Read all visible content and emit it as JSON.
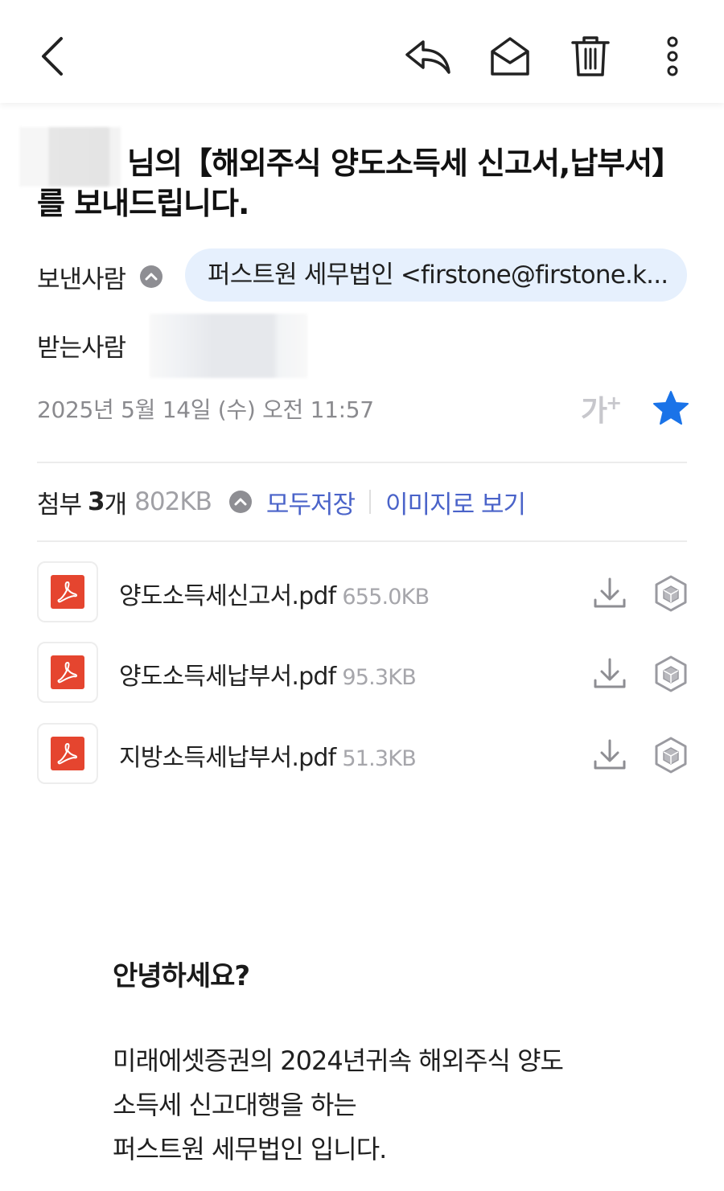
{
  "topbar": {
    "back_icon": "chevron-left-icon",
    "reply_icon": "reply-icon",
    "mark_read_icon": "envelope-open-icon",
    "delete_icon": "trash-icon",
    "more_icon": "more-vertical-icon"
  },
  "mail": {
    "subject": "님의【해외주식 양도소득세 신고서,납부서】를 보내드립니다.",
    "sender_label": "보낸사람",
    "sender": "퍼스트원 세무법인 <firstone@firstone.k...",
    "recipient_label": "받는사람",
    "date": "2025년 5월 14일 (수) 오전 11:57",
    "font_size_label": "가",
    "font_size_plus": "+",
    "starred": true,
    "star_color": "#1a73e8"
  },
  "attachments": {
    "label": "첨부",
    "count": "3",
    "count_unit": "개",
    "total_size": "802KB",
    "save_all": "모두저장",
    "view_as_image": "이미지로 보기",
    "files": [
      {
        "name": "양도소득세신고서.pdf",
        "size": "655.0KB"
      },
      {
        "name": "양도소득세납부서.pdf",
        "size": "95.3KB"
      },
      {
        "name": "지방소득세납부서.pdf",
        "size": "51.3KB"
      }
    ]
  },
  "body": {
    "greeting": "안녕하세요?",
    "lines": [
      "미래에셋증권의 2024년귀속 해외주식 양도",
      "소득세 신고대행을 하는",
      "퍼스트원 세무법인 입니다."
    ]
  },
  "colors": {
    "accent_link": "#4a63c9",
    "sender_chip_bg": "#e6f0fd",
    "pdf_red": "#e5452f"
  }
}
